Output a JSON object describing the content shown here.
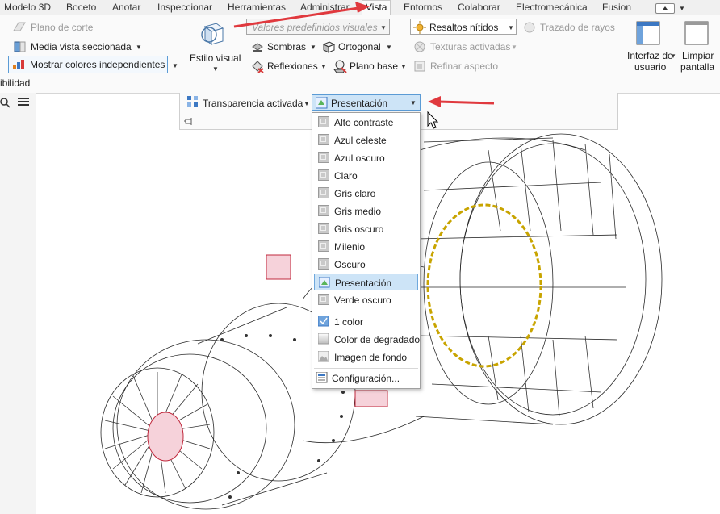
{
  "tabs": [
    {
      "label": "Modelo 3D"
    },
    {
      "label": "Boceto"
    },
    {
      "label": "Anotar"
    },
    {
      "label": "Inspeccionar"
    },
    {
      "label": "Herramientas"
    },
    {
      "label": "Administrar"
    },
    {
      "label": "Vista",
      "active": true
    },
    {
      "label": "Entornos"
    },
    {
      "label": "Colaborar"
    },
    {
      "label": "Electromecánica"
    },
    {
      "label": "Fusion"
    }
  ],
  "ribbon": {
    "left": {
      "plano_corte": "Plano de corte",
      "media_vista": "Media vista seccionada",
      "mostrar_colores": "Mostrar colores independientes",
      "visibilidad_partial": "ibilidad"
    },
    "estilo_visual": "Estilo visual",
    "valores_predefinidos_placeholder": "Valores predefinidos visuales",
    "sombras": "Sombras",
    "reflexiones": "Reflexiones",
    "ortogonal": "Ortogonal",
    "plano_base": "Plano base",
    "resaltos_nitidos": "Resaltos nítidos",
    "texturas_activadas": "Texturas activadas",
    "refinar_aspecto": "Refinar aspecto",
    "trazado_rayos": "Trazado de rayos",
    "interfaz_usuario": [
      "Interfaz de",
      "usuario"
    ],
    "limpiar_pantalla": [
      "Limpiar",
      "pantalla"
    ],
    "transparencia_activada": "Transparencia activada"
  },
  "appearance_combo": {
    "selected": "Presentación"
  },
  "appearance_menu": {
    "styles": [
      "Alto contraste",
      "Azul celeste",
      "Azul oscuro",
      "Claro",
      "Gris claro",
      "Gris medio",
      "Gris oscuro",
      "Milenio",
      "Oscuro",
      "Presentación",
      "Verde oscuro"
    ],
    "selected_index": 9,
    "background_options": [
      "1 color",
      "Color de degradado",
      "Imagen de fondo"
    ],
    "settings": "Configuración..."
  },
  "colors": {
    "accent": "#cde4f7",
    "accent_border": "#5b9bd5",
    "arrow_red": "#e0393e",
    "yellow_ring": "#c8a400",
    "red_part": "#c0283c"
  }
}
